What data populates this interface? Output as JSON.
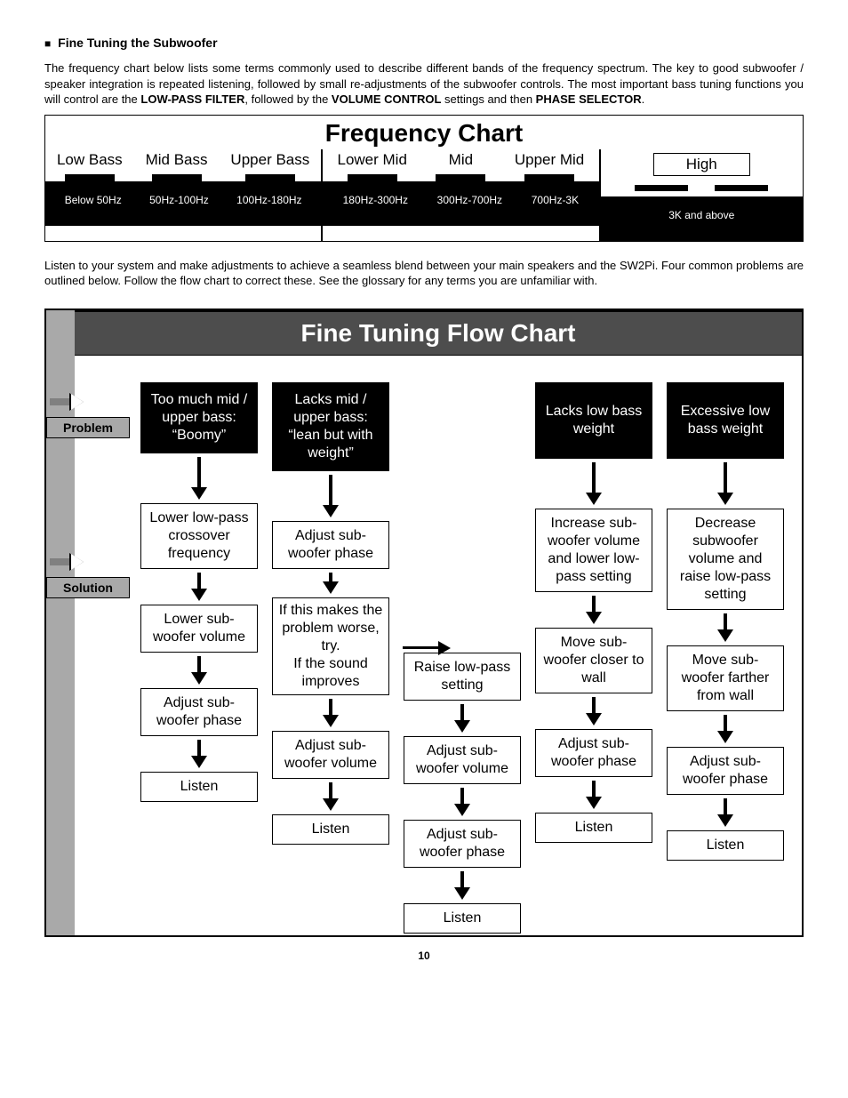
{
  "section_title": "Fine Tuning the Subwoofer",
  "intro": {
    "part1": "The frequency chart below lists some terms commonly used to describe different bands of the frequency spectrum.  The key to good subwoofer / speaker integration is repeated listening, followed by small re-adjustments of the subwoofer controls.  The most important bass tuning functions you will control are the ",
    "b1": "LOW-PASS FILTER",
    "part2": ", followed by the ",
    "b2": "VOLUME CONTROL",
    "part3": " settings and then ",
    "b3": "PHASE SELECTOR",
    "part4": "."
  },
  "freq_chart": {
    "title": "Frequency Chart",
    "bands": [
      {
        "label": "Low Bass",
        "range": "Below 50Hz"
      },
      {
        "label": "Mid Bass",
        "range": "50Hz-100Hz"
      },
      {
        "label": "Upper Bass",
        "range": "100Hz-180Hz"
      },
      {
        "label": "Lower Mid",
        "range": "180Hz-300Hz"
      },
      {
        "label": "Mid",
        "range": "300Hz-700Hz"
      },
      {
        "label": "Upper Mid",
        "range": "700Hz-3K"
      },
      {
        "label": "High",
        "range": "3K and above"
      }
    ]
  },
  "para2": "Listen to your system and make adjustments to achieve a seamless blend between your main speakers and the SW2Pi.  Four common problems are outlined below.  Follow the flow chart to correct these.  See the glossary for any terms you are unfamiliar with.",
  "flow": {
    "title": "Fine Tuning Flow Chart",
    "tags": {
      "problem": "Problem",
      "solution": "Solution"
    },
    "col1": {
      "problem": "Too much mid / upper bass: “Boomy”",
      "steps": [
        "Lower low-pass crossover frequency",
        "Lower sub-woofer volume",
        "Adjust sub-woofer phase",
        "Listen"
      ]
    },
    "col2": {
      "problem": "Lacks mid / upper bass: “lean but with weight”",
      "s1": "Adjust sub-woofer phase",
      "branch": "If this makes the problem worse, try.\nIf the sound improves",
      "steps": [
        "Adjust sub-woofer volume",
        "Listen"
      ]
    },
    "col3": {
      "steps": [
        "Raise low-pass setting",
        "Adjust sub-woofer volume",
        "Adjust sub-woofer phase",
        "Listen"
      ]
    },
    "col4": {
      "problem": "Lacks low bass weight",
      "steps": [
        "Increase sub-woofer volume and lower low-pass setting",
        "Move sub-woofer closer to wall",
        "Adjust sub-woofer phase",
        "Listen"
      ]
    },
    "col5": {
      "problem": "Excessive low bass weight",
      "steps": [
        "Decrease subwoofer volume and raise low-pass setting",
        "Move sub-woofer farther from wall",
        "Adjust sub-woofer phase",
        "Listen"
      ]
    }
  },
  "page_number": "10"
}
